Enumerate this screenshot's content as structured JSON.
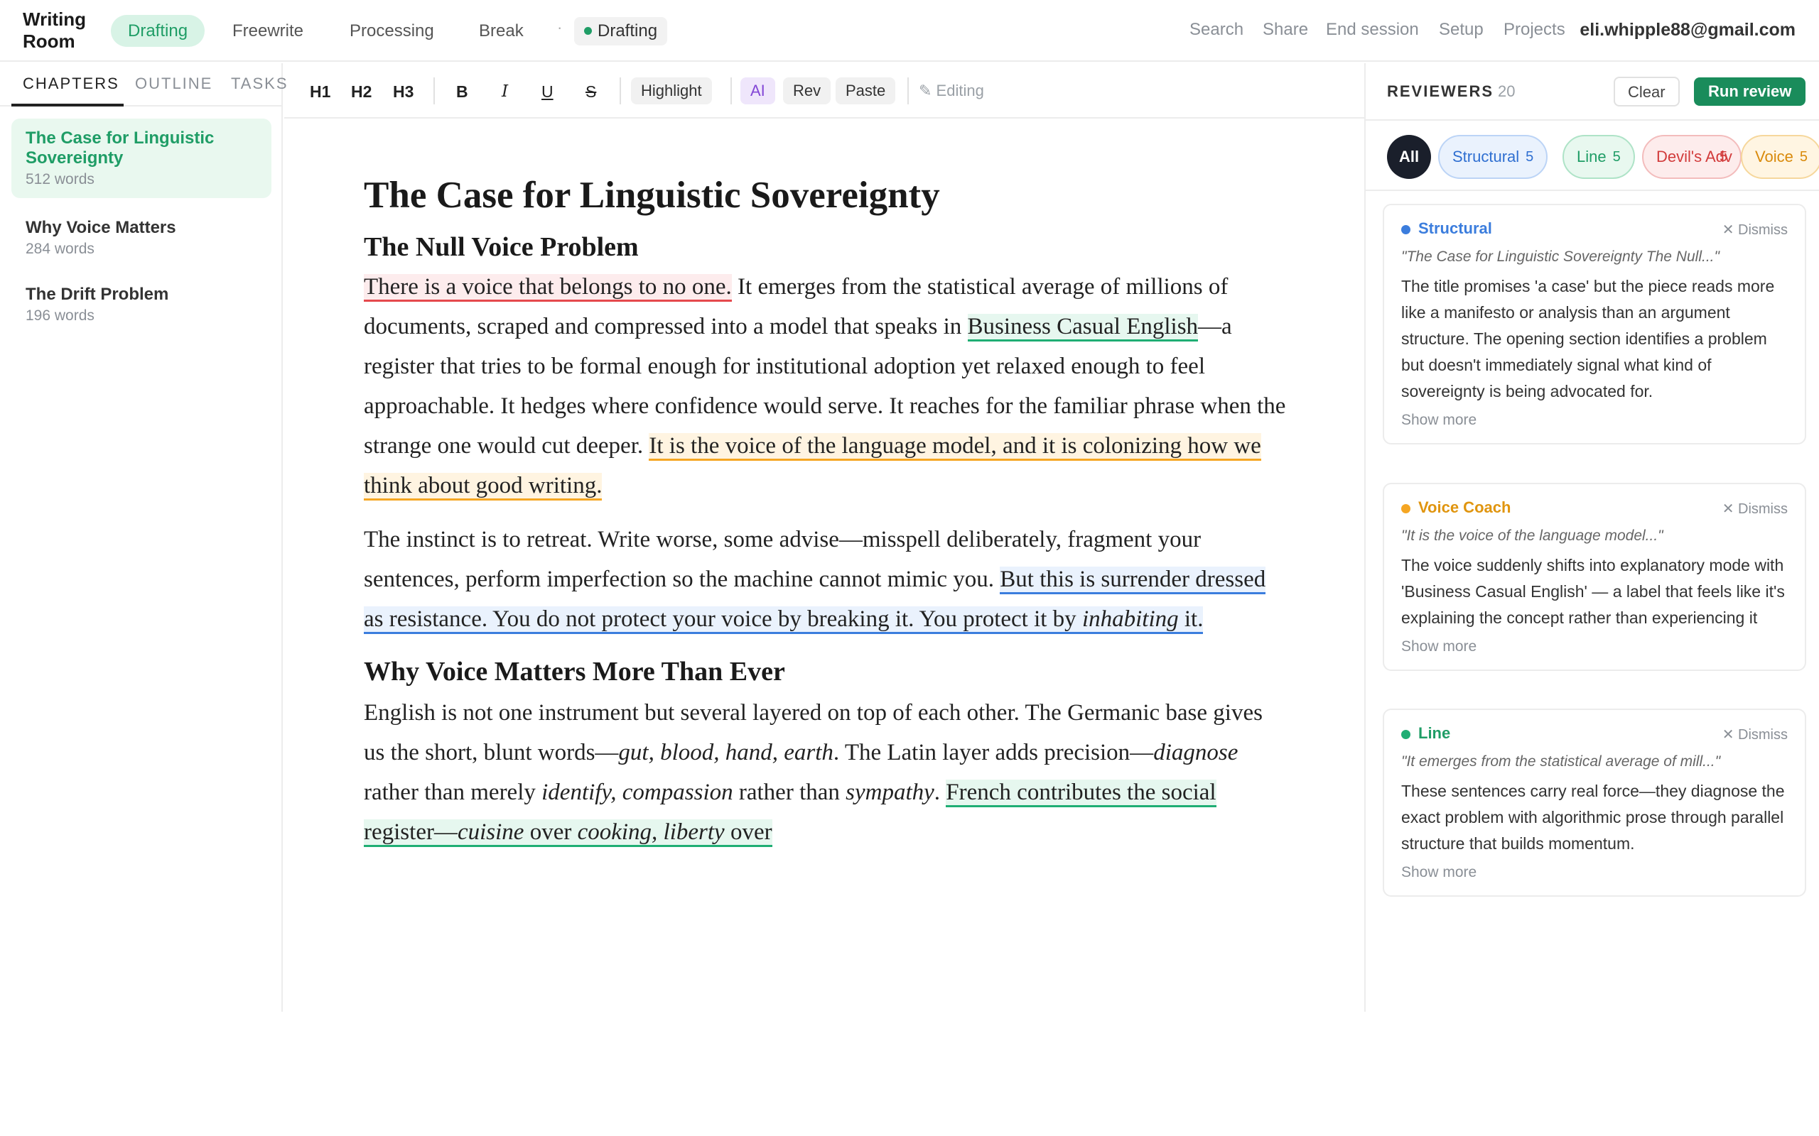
{
  "app": {
    "title": "Writing Room",
    "modes": [
      "Drafting",
      "Freewrite",
      "Processing",
      "Break"
    ],
    "separator": "·",
    "status": "Drafting",
    "nav": [
      "Search",
      "Share",
      "End session",
      "Setup",
      "Projects"
    ],
    "user_email": "eli.whipple88@gmail.com",
    "accent_color": "#1f9d66"
  },
  "sidebar": {
    "tabs": [
      "CHAPTERS",
      "OUTLINE",
      "TASKS"
    ],
    "chapters": [
      {
        "title": "The Case for Linguistic Sovereignty",
        "words": "512 words"
      },
      {
        "title": "Why Voice Matters",
        "words": "284 words"
      },
      {
        "title": "The Drift Problem",
        "words": "196 words"
      }
    ]
  },
  "toolbar": {
    "h1": "H1",
    "h2": "H2",
    "h3": "H3",
    "bold": "B",
    "italic": "I",
    "underline": "U",
    "strike": "S",
    "highlight": "Highlight",
    "ai": "AI",
    "rev": "Rev",
    "paste": "Paste",
    "editing": "✎ Editing"
  },
  "document": {
    "title": "The Case for Linguistic Sovereignty",
    "section1": "The Null Voice Problem",
    "p1": {
      "a": "There is a voice that belongs to no one.",
      "b": " It emerges from the statistical average of millions of documents, scraped and compressed into a model that speaks in ",
      "c": "Business Casual English",
      "d": "—a register that tries to be formal enough for institutional adoption yet relaxed enough to feel approachable. It hedges where confidence would serve. It reaches for the familiar phrase when the strange one would cut deeper. ",
      "e": "It is the voice of the language model, and it is colonizing how we think about good writing."
    },
    "p2": {
      "a": "The instinct is to retreat. Write worse, some advise—misspell deliberately, fragment your sentences, perform imperfection so the machine cannot mimic you. ",
      "b": "But this is surrender dressed as resistance. You do not protect your voice by breaking it. You protect it by ",
      "c": "inhabiting",
      "d": " it."
    },
    "section2": "Why Voice Matters More Than Ever",
    "p3": {
      "a": "English is not one instrument but several layered on top of each other. The Germanic base gives us the short, blunt words—",
      "b": "gut, blood, hand, earth",
      "c": ". The Latin layer adds precision—",
      "d": "diagnose",
      "e": " rather than merely ",
      "f": "identify, compassion",
      "g": " rather than ",
      "h": "sympathy",
      "i": ". ",
      "j": "French contributes the social register—",
      "k": "cuisine",
      "l": " over ",
      "m": "cooking, liberty",
      "n": " over"
    }
  },
  "reviewers": {
    "title": "REVIEWERS",
    "count": "20",
    "clear": "Clear",
    "run": "Run review",
    "filters": [
      {
        "label": "All"
      },
      {
        "label": "Structural",
        "count": "5"
      },
      {
        "label": "Line",
        "count": "5"
      },
      {
        "label": "Devil's Adv",
        "count": "5"
      },
      {
        "label": "Voice",
        "count": "5"
      }
    ],
    "cards": [
      {
        "category": "Structural",
        "color": "#3b7ddd",
        "dismiss": "✕ Dismiss",
        "quote": "\"The Case for Linguistic Sovereignty The Null...\"",
        "body": "The title promises 'a case' but the piece reads more like a manifesto or analysis than an argument structure. The opening section identifies a problem but doesn't immediately signal what kind of sovereignty is being advocated for.",
        "more": "Show more"
      },
      {
        "category": "Voice Coach",
        "color": "#f5a623",
        "dismiss": "✕ Dismiss",
        "quote": "\"It is the voice of the language model...\"",
        "body": "The voice suddenly shifts into explanatory mode with 'Business Casual English' — a label that feels like it's explaining the concept rather than experiencing it",
        "more": "Show more"
      },
      {
        "category": "Line",
        "color": "#1fae74",
        "dismiss": "✕ Dismiss",
        "quote": "\"It emerges from the statistical average of mill...\"",
        "body": "These sentences carry real force—they diagnose the exact problem with algorithmic prose through parallel structure that builds momentum.",
        "more": "Show more"
      }
    ]
  }
}
